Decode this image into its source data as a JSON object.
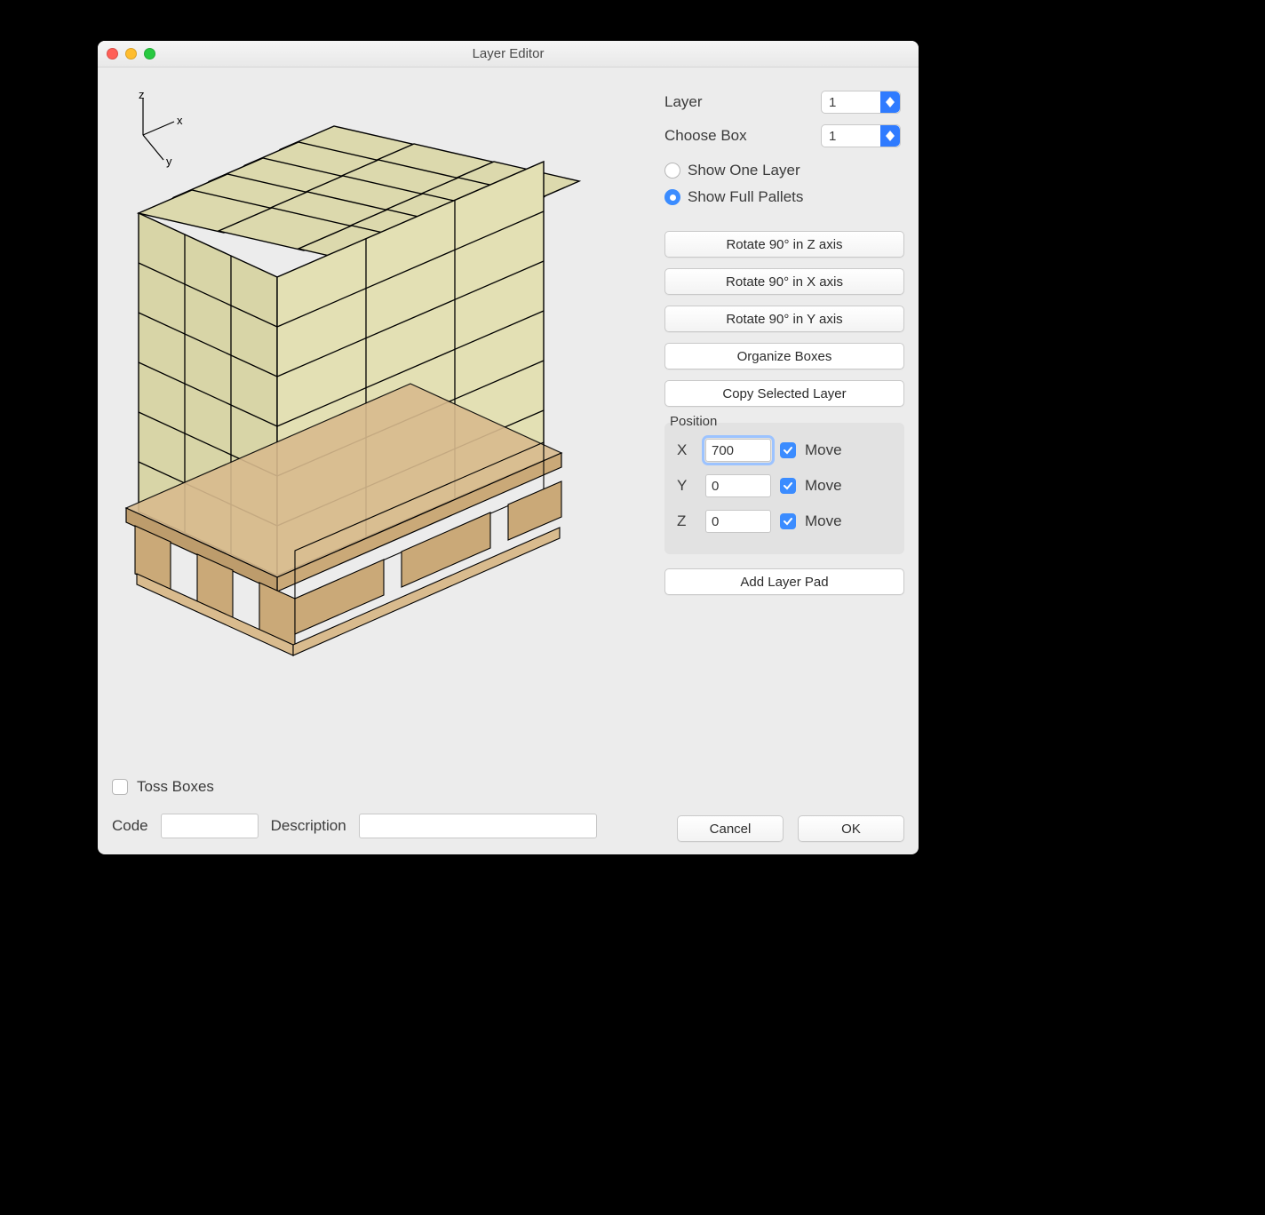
{
  "window": {
    "title": "Layer Editor"
  },
  "controls": {
    "layer_label": "Layer",
    "layer_value": "1",
    "choosebox_label": "Choose Box",
    "choosebox_value": "1",
    "show_one_layer": "Show One Layer",
    "show_full_pallets": "Show Full Pallets",
    "view_mode_selected": "full",
    "rotate_z": "Rotate 90° in Z axis",
    "rotate_x": "Rotate 90° in X axis",
    "rotate_y": "Rotate 90° in Y axis",
    "organize": "Organize Boxes",
    "copy_layer": "Copy Selected Layer",
    "position_legend": "Position",
    "axes": {
      "x": {
        "label": "X",
        "value": "700",
        "move_label": "Move",
        "move_checked": true,
        "focused": true
      },
      "y": {
        "label": "Y",
        "value": "0",
        "move_label": "Move",
        "move_checked": true,
        "focused": false
      },
      "z": {
        "label": "Z",
        "value": "0",
        "move_label": "Move",
        "move_checked": true,
        "focused": false
      }
    },
    "add_layer_pad": "Add Layer Pad",
    "cancel": "Cancel",
    "ok": "OK"
  },
  "left": {
    "toss_boxes": "Toss Boxes",
    "toss_checked": false,
    "code_label": "Code",
    "code_value": "",
    "description_label": "Description",
    "description_value": ""
  },
  "axis_indicator": {
    "z": "z",
    "x": "x",
    "y": "y"
  }
}
